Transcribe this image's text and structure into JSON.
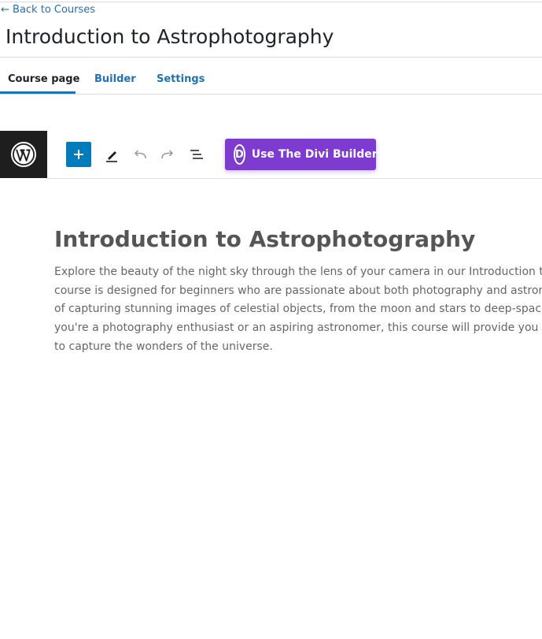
{
  "header": {
    "back_link": "← Back to Courses",
    "title": "Introduction to Astrophotography"
  },
  "tabs": [
    {
      "label": "Course page",
      "active": true
    },
    {
      "label": "Builder",
      "active": false
    },
    {
      "label": "Settings",
      "active": false
    }
  ],
  "toolbar": {
    "logo_icon": "wordpress-logo-icon",
    "add_icon": "plus-icon",
    "pen_icon": "pencil-icon",
    "undo_icon": "undo-icon",
    "redo_icon": "redo-icon",
    "list_icon": "list-view-icon",
    "divi_icon_letter": "D",
    "divi_button_label": "Use The Divi Builder"
  },
  "content": {
    "heading": "Introduction to Astrophotography",
    "paragraph_lines": [
      "Explore the beauty of the night sky through the lens of your camera in our Introduction to Astro",
      "course is designed for beginners who are passionate about both photography and astronomy. Y",
      "of capturing stunning images of celestial objects, from the moon and stars to deep-space galaxi",
      "you're a photography enthusiast or an aspiring astronomer, this course will provide you with th",
      "to capture the wonders of the universe."
    ]
  },
  "colors": {
    "link_blue": "#2271b1",
    "add_button_blue": "#007cba",
    "divi_purple": "#7e3bd0",
    "toolbar_dark": "#1e1e1e",
    "heading_gray": "#555555",
    "body_gray": "#666666"
  }
}
